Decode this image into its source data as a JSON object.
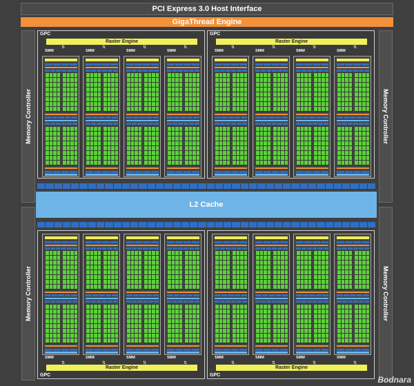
{
  "title": "PCI Express 3.0 Host Interface",
  "giga": "GigaThread Engine",
  "memctrl": "Memory Controller",
  "l2": "L2 Cache",
  "gpc_label": "GPC",
  "raster_label": "Raster Engine",
  "smm_label": "SMM",
  "watermark": "Bodnara",
  "colors": {
    "core": "#5cd23a",
    "blue": "#2f6fc4",
    "lightblue": "#6fb4e6",
    "orange": "#f2913a",
    "yellow": "#f0f05a"
  }
}
